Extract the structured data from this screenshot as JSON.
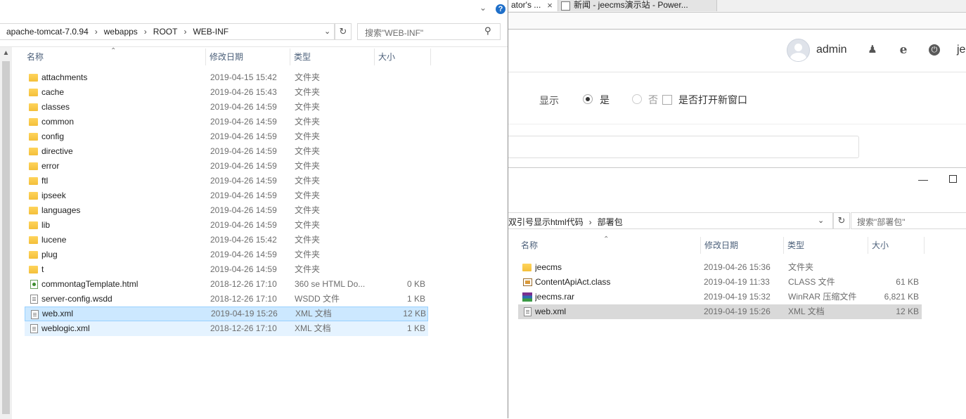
{
  "browser": {
    "tabs": [
      {
        "label": "ator's ...",
        "close": "×"
      },
      {
        "label": "新闻 - jeecms演示站 - Power..."
      }
    ],
    "header": {
      "username": "admin",
      "cut_text": "je",
      "icons": [
        "user-icon",
        "ie-icon",
        "power-icon"
      ]
    },
    "form": {
      "show_label": "显示",
      "yes_label": "是",
      "no_label": "否",
      "selected": "是",
      "new_window_label": "是否打开新窗口",
      "new_window_checked": false
    }
  },
  "explorer2": {
    "controls": {
      "minimize": "—"
    },
    "breadcrumb": [
      "双引号显示html代码",
      "部署包"
    ],
    "search_placeholder": "搜索\"部署包\"",
    "columns": [
      "名称",
      "修改日期",
      "类型",
      "大小"
    ],
    "files": [
      {
        "name": "jeecms",
        "date": "2019-04-26 15:36",
        "type": "文件夹",
        "size": "",
        "icon": "folder"
      },
      {
        "name": "ContentApiAct.class",
        "date": "2019-04-19 11:33",
        "type": "CLASS 文件",
        "size": "61 KB",
        "icon": "class"
      },
      {
        "name": "jeecms.rar",
        "date": "2019-04-19 15:32",
        "type": "WinRAR 压缩文件",
        "size": "6,821 KB",
        "icon": "rar"
      },
      {
        "name": "web.xml",
        "date": "2019-04-19 15:26",
        "type": "XML 文档",
        "size": "12 KB",
        "icon": "xml",
        "selected": true
      }
    ]
  },
  "explorer1": {
    "help": "?",
    "breadcrumb": [
      "apache-tomcat-7.0.94",
      "webapps",
      "ROOT",
      "WEB-INF"
    ],
    "search_placeholder": "搜索\"WEB-INF\"",
    "columns": [
      "名称",
      "修改日期",
      "类型",
      "大小"
    ],
    "files": [
      {
        "name": "attachments",
        "date": "2019-04-15 15:42",
        "type": "文件夹",
        "size": "",
        "icon": "folder"
      },
      {
        "name": "cache",
        "date": "2019-04-26 15:43",
        "type": "文件夹",
        "size": "",
        "icon": "folder"
      },
      {
        "name": "classes",
        "date": "2019-04-26 14:59",
        "type": "文件夹",
        "size": "",
        "icon": "folder"
      },
      {
        "name": "common",
        "date": "2019-04-26 14:59",
        "type": "文件夹",
        "size": "",
        "icon": "folder"
      },
      {
        "name": "config",
        "date": "2019-04-26 14:59",
        "type": "文件夹",
        "size": "",
        "icon": "folder"
      },
      {
        "name": "directive",
        "date": "2019-04-26 14:59",
        "type": "文件夹",
        "size": "",
        "icon": "folder"
      },
      {
        "name": "error",
        "date": "2019-04-26 14:59",
        "type": "文件夹",
        "size": "",
        "icon": "folder"
      },
      {
        "name": "ftl",
        "date": "2019-04-26 14:59",
        "type": "文件夹",
        "size": "",
        "icon": "folder"
      },
      {
        "name": "ipseek",
        "date": "2019-04-26 14:59",
        "type": "文件夹",
        "size": "",
        "icon": "folder"
      },
      {
        "name": "languages",
        "date": "2019-04-26 14:59",
        "type": "文件夹",
        "size": "",
        "icon": "folder"
      },
      {
        "name": "lib",
        "date": "2019-04-26 14:59",
        "type": "文件夹",
        "size": "",
        "icon": "folder"
      },
      {
        "name": "lucene",
        "date": "2019-04-26 15:42",
        "type": "文件夹",
        "size": "",
        "icon": "folder"
      },
      {
        "name": "plug",
        "date": "2019-04-26 14:59",
        "type": "文件夹",
        "size": "",
        "icon": "folder"
      },
      {
        "name": "t",
        "date": "2019-04-26 14:59",
        "type": "文件夹",
        "size": "",
        "icon": "folder"
      },
      {
        "name": "commontagTemplate.html",
        "date": "2018-12-26 17:10",
        "type": "360 se HTML Do...",
        "size": "0 KB",
        "icon": "html"
      },
      {
        "name": "server-config.wsdd",
        "date": "2018-12-26 17:10",
        "type": "WSDD 文件",
        "size": "1 KB",
        "icon": "doc"
      },
      {
        "name": "web.xml",
        "date": "2019-04-19 15:26",
        "type": "XML 文档",
        "size": "12 KB",
        "icon": "xml",
        "selected": true
      },
      {
        "name": "weblogic.xml",
        "date": "2018-12-26 17:10",
        "type": "XML 文档",
        "size": "1 KB",
        "icon": "xml",
        "hover": true
      }
    ]
  },
  "colors": {
    "selected_row": "#cce8ff",
    "selected_border": "#99d1ff",
    "hover_row": "#e5f3ff",
    "inactive_selected_row": "#d9d9d9",
    "folder": "#f4bf3a",
    "help_button": "#1f6fc9"
  }
}
